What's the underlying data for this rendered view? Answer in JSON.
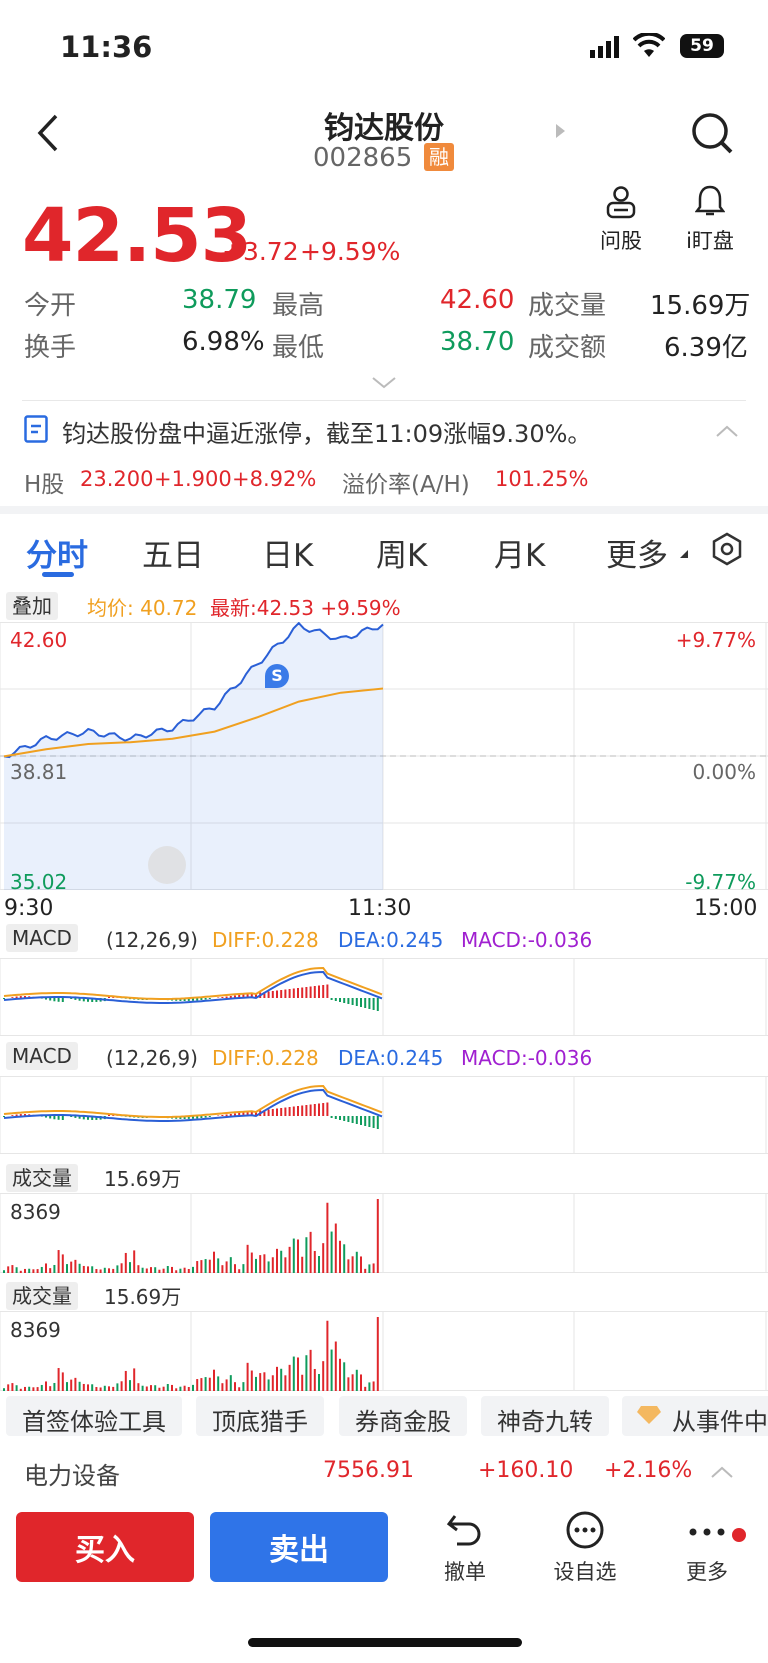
{
  "status": {
    "time": "11:36",
    "battery": "59"
  },
  "header": {
    "title": "钧达股份",
    "code": "002865",
    "badge": "融"
  },
  "quote": {
    "price": "42.53",
    "change": "+3.72",
    "change_pct": "+9.59%",
    "ask_label": "问股",
    "watch_label": "i盯盘",
    "stats": [
      {
        "label": "今开",
        "value": "38.79"
      },
      {
        "label": "最高",
        "value": "42.60"
      },
      {
        "label": "成交量",
        "value": "15.69万"
      },
      {
        "label": "换手",
        "value": "6.98%"
      },
      {
        "label": "最低",
        "value": "38.70"
      },
      {
        "label": "成交额",
        "value": "6.39亿"
      }
    ]
  },
  "news": {
    "text": "钧达股份盘中逼近涨停，截至11:09涨幅9.30%。"
  },
  "hshare": {
    "label": "H股",
    "price": "23.200",
    "change": "+1.900",
    "pct": "+8.92%",
    "premium_label": "溢价率(A/H)",
    "premium": "101.25%"
  },
  "tabs": [
    "分时",
    "五日",
    "日K",
    "周K",
    "月K",
    "更多"
  ],
  "chart_header": {
    "overlay": "叠加",
    "avg": "均价: 40.72",
    "latest": "最新:42.53 +9.59%"
  },
  "price_chart": {
    "high": "42.60",
    "mid": "38.81",
    "low": "35.02",
    "high_pct": "+9.77%",
    "mid_pct": "0.00%",
    "low_pct": "-9.77%",
    "t0": "9:30",
    "t1": "11:30",
    "t2": "15:00",
    "marker": "S"
  },
  "macd": {
    "label": "MACD",
    "params": "(12,26,9)",
    "diff": "DIFF:0.228",
    "dea": "DEA:0.245",
    "macd": "MACD:-0.036"
  },
  "volume": {
    "label": "成交量",
    "total": "15.69万",
    "max": "8369"
  },
  "tools": [
    "首签体验工具",
    "顶底猎手",
    "券商金股",
    "神奇九转",
    "从事件中"
  ],
  "sector": {
    "name": "电力设备",
    "value": "7556.91",
    "change": "+160.10",
    "pct": "+2.16%"
  },
  "bottom": {
    "buy": "买入",
    "sell": "卖出",
    "cancel": "撤单",
    "watchlist": "设自选",
    "more": "更多"
  },
  "chart_data": [
    {
      "type": "line",
      "title": "",
      "x_range": [
        "9:30",
        "15:00"
      ],
      "ylim": [
        35.02,
        42.6
      ],
      "series": [
        {
          "name": "",
          "x": [
            "9:30",
            "9:45",
            "10:00",
            "10:15",
            "10:30",
            "10:45",
            "11:00",
            "11:10",
            "11:20",
            "11:30"
          ],
          "values": [
            38.8,
            39.3,
            39.5,
            39.3,
            39.6,
            40.2,
            41.4,
            42.5,
            42.1,
            42.53
          ]
        },
        {
          "name": "均价",
          "x": [
            "9:30",
            "9:45",
            "10:00",
            "10:15",
            "10:30",
            "10:45",
            "11:00",
            "11:10",
            "11:20",
            "11:30"
          ],
          "values": [
            38.8,
            39.0,
            39.15,
            39.2,
            39.3,
            39.5,
            39.9,
            40.35,
            40.6,
            40.72
          ]
        }
      ]
    },
    {
      "type": "bar",
      "title": "成交量",
      "ylim": [
        0,
        8369
      ],
      "values": [
        900,
        500,
        700,
        1200,
        2600,
        1500,
        800,
        600,
        1100,
        2900,
        900,
        700,
        800,
        600,
        1500,
        2500,
        1800,
        1200,
        3200,
        2200,
        2800,
        3900,
        4700,
        3600,
        8369,
        3700,
        2400,
        1100,
        8369
      ]
    }
  ]
}
